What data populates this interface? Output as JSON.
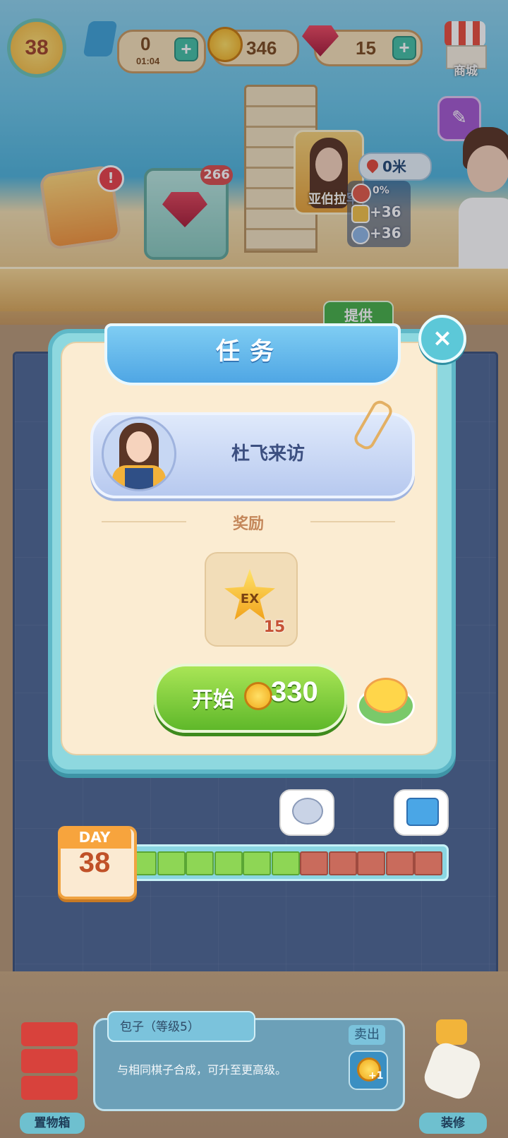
{
  "hud": {
    "level": "38",
    "energy": "0",
    "energy_timer": "01:04",
    "coins": "346",
    "gems": "15",
    "shop_label": "商城"
  },
  "scene": {
    "gem_crate_count": "266",
    "npc_name": "亚伯拉罕",
    "distance": "0米",
    "progress_percent": "0%",
    "stat_1": "+36",
    "stat_2": "+36",
    "supply_button": "提供"
  },
  "modal": {
    "title": "任务",
    "task_name": "杜飞来访",
    "reward_label": "奖励",
    "reward_icon_text": "EX",
    "reward_count": "15",
    "start_label": "开始",
    "start_cost": "330"
  },
  "day_bar": {
    "day_label": "DAY",
    "day_number": "38",
    "filled_segments": 6,
    "total_segments": 11
  },
  "bottom": {
    "item_title": "包子（等级5）",
    "item_desc": "与相同棋子合成，可升至更高级。",
    "sell_label": "卖出",
    "sell_value": "+1",
    "storage_label": "置物箱",
    "renovate_label": "装修"
  },
  "colors": {
    "filled_segment": "#8ed655",
    "empty_segment": "#c96b5c",
    "accent_teal": "#5fb8c8",
    "start_green": "#6cc233"
  }
}
